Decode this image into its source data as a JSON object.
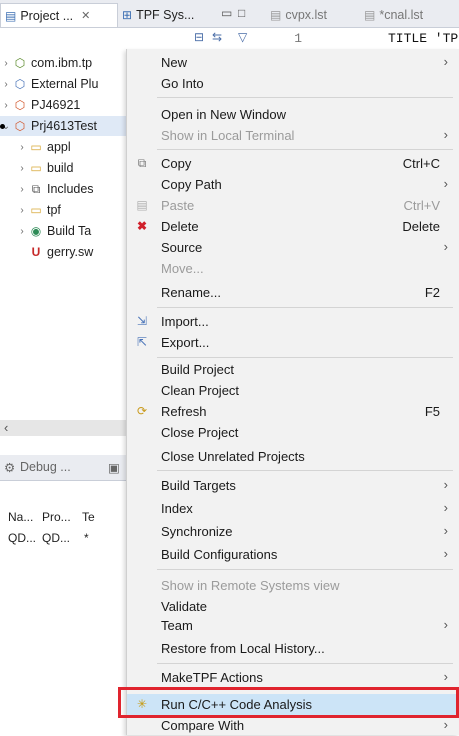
{
  "tabs": {
    "project_explorer": "Project ...",
    "project_close": "✕",
    "tpf_system": "TPF Sys...",
    "minimize": "▭",
    "maximize": "□",
    "editor1": "cvpx.lst",
    "editor2": "*cnal.lst"
  },
  "editor": {
    "line_number": "1",
    "code": "TITLE 'TP"
  },
  "tree": {
    "items": [
      {
        "label": "com.ibm.tp",
        "icon": "⬡"
      },
      {
        "label": "External Plu",
        "icon": "⬡"
      },
      {
        "label": "PJ46921",
        "icon": "⬡"
      },
      {
        "label": "Prj4613Test",
        "icon": "⬡"
      },
      {
        "label": "appl",
        "icon": "📂"
      },
      {
        "label": "build",
        "icon": "📂"
      },
      {
        "label": "Includes",
        "icon": "⬡"
      },
      {
        "label": "tpf",
        "icon": "📂"
      },
      {
        "label": "Build Ta",
        "icon": "◉"
      },
      {
        "label": "gerry.sw",
        "icon": "U"
      }
    ]
  },
  "bottom": {
    "tab_debug": "Debug ...",
    "col_name": "Na...",
    "col_pro": "Pro...",
    "col_te": "Te",
    "val_name": "QD...",
    "val_pro": "QD...",
    "val_te": "*"
  },
  "menu": {
    "new": "New",
    "go_into": "Go Into",
    "open_new_window": "Open in New Window",
    "show_local_terminal": "Show in Local Terminal",
    "copy": "Copy",
    "copy_acc": "Ctrl+C",
    "copy_path": "Copy Path",
    "paste": "Paste",
    "paste_acc": "Ctrl+V",
    "delete": "Delete",
    "delete_acc": "Delete",
    "source": "Source",
    "move": "Move...",
    "rename": "Rename...",
    "rename_acc": "F2",
    "import": "Import...",
    "export": "Export...",
    "build_project": "Build Project",
    "clean_project": "Clean Project",
    "refresh": "Refresh",
    "refresh_acc": "F5",
    "close_project": "Close Project",
    "close_unrelated": "Close Unrelated Projects",
    "build_targets": "Build Targets",
    "index": "Index",
    "synchronize": "Synchronize",
    "build_configurations": "Build Configurations",
    "show_remote": "Show in Remote Systems view",
    "validate": "Validate",
    "team": "Team",
    "restore_history": "Restore from Local History...",
    "maketpf_actions": "MakeTPF Actions",
    "run_code_analysis": "Run C/C++ Code Analysis",
    "compare_with": "Compare With",
    "submenu_arrow": "›"
  },
  "colors": {
    "highlight": "#cce4f7",
    "red_box": "#e0242e",
    "menu_bg": "#f2f2f2"
  }
}
